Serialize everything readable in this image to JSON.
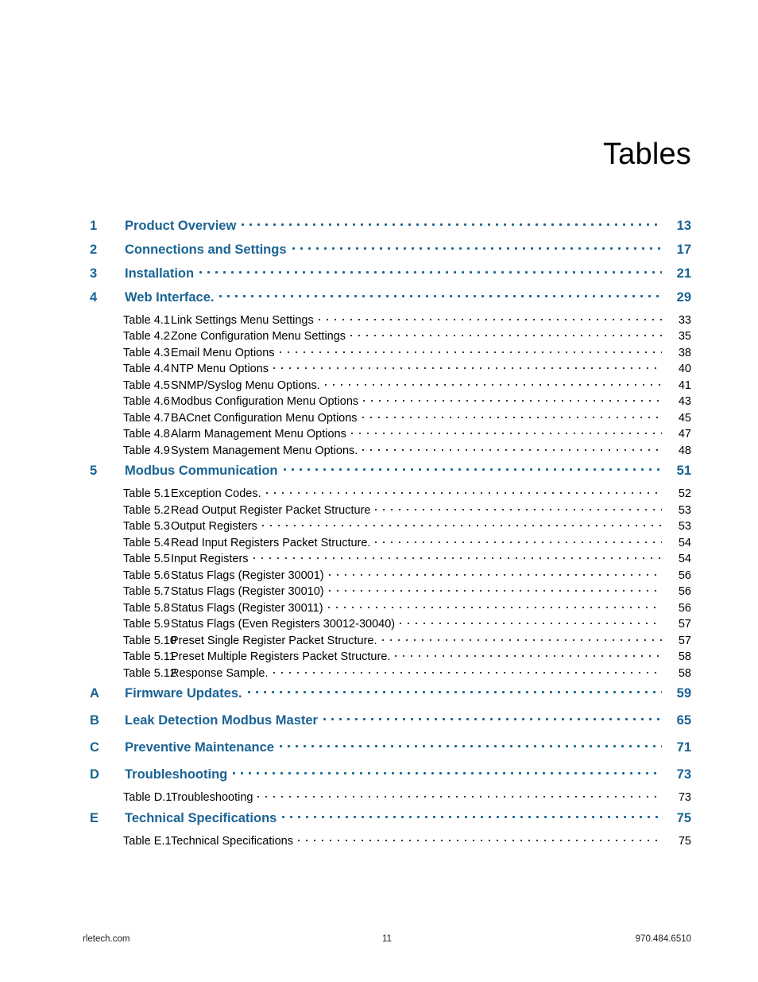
{
  "document": {
    "title": "Tables"
  },
  "toc": {
    "entries": [
      {
        "kind": "chapter",
        "num": "1",
        "title": "Product Overview",
        "page": "13"
      },
      {
        "kind": "chapter",
        "num": "2",
        "title": "Connections and Settings",
        "page": "17"
      },
      {
        "kind": "chapter",
        "num": "3",
        "title": "Installation",
        "page": "21"
      },
      {
        "kind": "chapter",
        "num": "4",
        "title": "Web Interface.",
        "page": "29"
      },
      {
        "kind": "table",
        "num": "Table 4.1",
        "title": "Link Settings Menu Settings",
        "page": "33"
      },
      {
        "kind": "table",
        "num": "Table 4.2",
        "title": "Zone Configuration Menu Settings",
        "page": "35"
      },
      {
        "kind": "table",
        "num": "Table 4.3",
        "title": "Email Menu Options",
        "page": "38"
      },
      {
        "kind": "table",
        "num": "Table 4.4",
        "title": "NTP Menu Options",
        "page": "40"
      },
      {
        "kind": "table",
        "num": "Table 4.5",
        "title": "SNMP/Syslog Menu Options.",
        "page": "41"
      },
      {
        "kind": "table",
        "num": "Table 4.6",
        "title": "Modbus Configuration Menu Options",
        "page": "43"
      },
      {
        "kind": "table",
        "num": "Table 4.7",
        "title": "BACnet Configuration Menu Options",
        "page": "45"
      },
      {
        "kind": "table",
        "num": "Table 4.8",
        "title": "Alarm Management Menu Options",
        "page": "47"
      },
      {
        "kind": "table",
        "num": "Table 4.9",
        "title": "System Management Menu Options.",
        "page": "48"
      },
      {
        "kind": "chapter",
        "num": "5",
        "title": "Modbus Communication",
        "page": "51",
        "group": true
      },
      {
        "kind": "table",
        "num": "Table 5.1",
        "title": "Exception Codes.",
        "page": "52"
      },
      {
        "kind": "table",
        "num": "Table 5.2",
        "title": "Read Output Register Packet Structure",
        "page": "53"
      },
      {
        "kind": "table",
        "num": "Table 5.3",
        "title": "Output Registers",
        "page": "53"
      },
      {
        "kind": "table",
        "num": "Table 5.4",
        "title": "Read Input Registers Packet Structure.",
        "page": "54"
      },
      {
        "kind": "table",
        "num": "Table 5.5",
        "title": "Input Registers",
        "page": "54"
      },
      {
        "kind": "table",
        "num": "Table 5.6",
        "title": "Status Flags (Register 30001)",
        "page": "56"
      },
      {
        "kind": "table",
        "num": "Table 5.7",
        "title": "Status Flags (Register 30010)",
        "page": "56"
      },
      {
        "kind": "table",
        "num": "Table 5.8",
        "title": "Status Flags (Register 30011)",
        "page": "56"
      },
      {
        "kind": "table",
        "num": "Table 5.9",
        "title": "Status Flags (Even Registers 30012-30040)",
        "page": "57"
      },
      {
        "kind": "table",
        "num": "Table 5.10",
        "title": "Preset Single Register Packet Structure.",
        "page": "57"
      },
      {
        "kind": "table",
        "num": "Table 5.11",
        "title": "Preset Multiple Registers Packet Structure.",
        "page": "58"
      },
      {
        "kind": "table",
        "num": "Table 5.12",
        "title": "Response Sample.",
        "page": "58"
      },
      {
        "kind": "chapter",
        "num": "A",
        "title": "Firmware Updates.",
        "page": "59",
        "group": true
      },
      {
        "kind": "chapter",
        "num": "B",
        "title": "Leak Detection Modbus Master",
        "page": "65",
        "group": true
      },
      {
        "kind": "chapter",
        "num": "C",
        "title": "Preventive Maintenance",
        "page": "71",
        "group": true
      },
      {
        "kind": "chapter",
        "num": "D",
        "title": "Troubleshooting",
        "page": "73",
        "group": true
      },
      {
        "kind": "table",
        "num": "Table D.1",
        "title": "Troubleshooting",
        "page": "73"
      },
      {
        "kind": "chapter",
        "num": "E",
        "title": "Technical Specifications",
        "page": "75",
        "group": true
      },
      {
        "kind": "table",
        "num": "Table E.1",
        "title": "Technical Specifications",
        "page": "75"
      }
    ]
  },
  "footer": {
    "website": "rletech.com",
    "page_number": "11",
    "phone": "970.484.6510"
  },
  "colors": {
    "accent_blue": "#1a6394",
    "text_black": "#000000",
    "page_background": "#ffffff"
  }
}
